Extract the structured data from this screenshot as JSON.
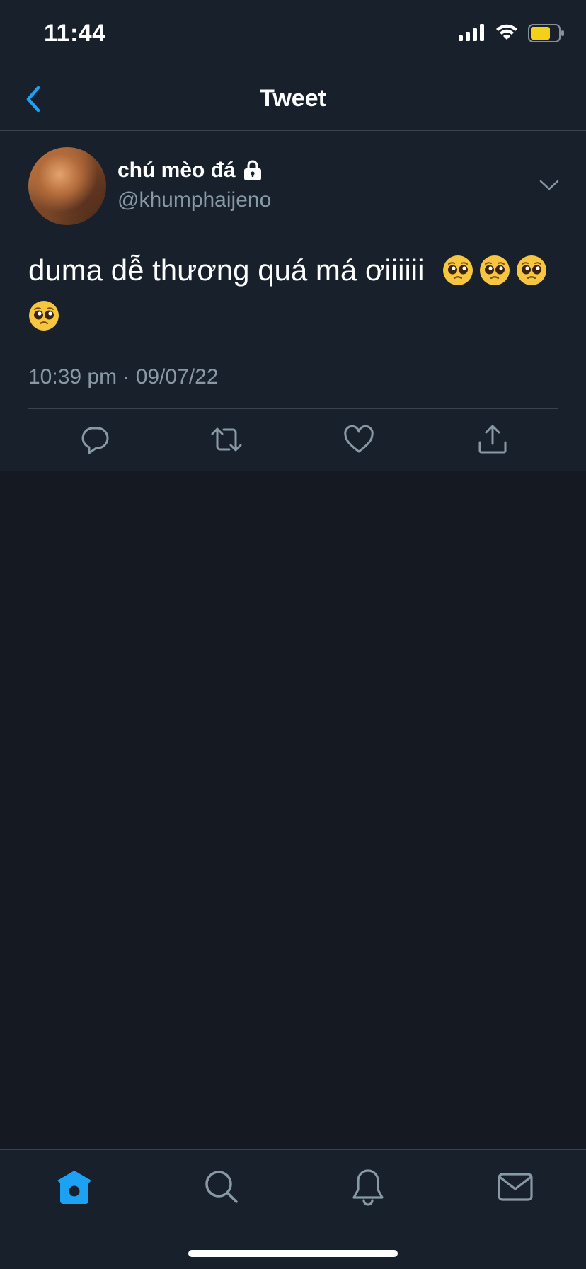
{
  "status_bar": {
    "time": "11:44",
    "battery_color": "#f5d018"
  },
  "header": {
    "title": "Tweet",
    "back_icon": "chevron-left-icon"
  },
  "tweet": {
    "author_name": "chú mèo đá",
    "protected_icon": "lock-icon",
    "handle": "@khumphaijeno",
    "text": "duma dễ thương quá má ơiiiiii",
    "emoji": "pleading-face",
    "emoji_count": 4,
    "timestamp": "10:39 pm · 09/07/22"
  },
  "actions": [
    {
      "name": "reply",
      "icon": "reply-icon"
    },
    {
      "name": "retweet",
      "icon": "retweet-icon"
    },
    {
      "name": "like",
      "icon": "heart-icon"
    },
    {
      "name": "share",
      "icon": "share-icon"
    }
  ],
  "tab_bar": [
    {
      "name": "home",
      "icon": "home-icon",
      "active": true
    },
    {
      "name": "search",
      "icon": "search-icon",
      "active": false
    },
    {
      "name": "notifications",
      "icon": "bell-icon",
      "active": false
    },
    {
      "name": "messages",
      "icon": "mail-icon",
      "active": false
    }
  ],
  "colors": {
    "accent": "#1da1f2",
    "background": "#141922",
    "surface": "#18202b",
    "secondary_text": "#8899a6",
    "divider": "#38444d"
  }
}
